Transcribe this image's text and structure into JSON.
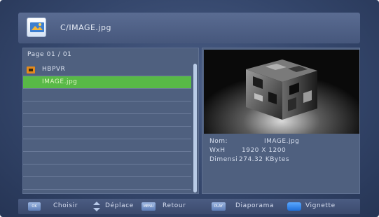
{
  "header": {
    "path": "C/IMAGE.jpg"
  },
  "file_list": {
    "page_label": "Page  01 / 01",
    "items": [
      {
        "label": "HBPVR",
        "type": "folder",
        "selected": false
      },
      {
        "label": "IMAGE.jpg",
        "type": "file",
        "selected": true
      }
    ]
  },
  "preview": {
    "name_label": "Nom:",
    "name_value": "IMAGE.jpg",
    "size_label": "WxH",
    "size_value": "1920 X 1200",
    "filesize_label": "Dimensi",
    "filesize_value": "274.32 KBytes"
  },
  "footer": {
    "ok_key": "OK",
    "ok_label": "Choisir",
    "move_label": "Déplace",
    "menu_key": "MENU",
    "back_label": "Retour",
    "play_key": "PLAY",
    "slideshow_label": "Diaporama",
    "thumbnail_label": "Vignette"
  },
  "colors": {
    "selection": "#58b947",
    "accent_blue": "#1f6fd8"
  }
}
